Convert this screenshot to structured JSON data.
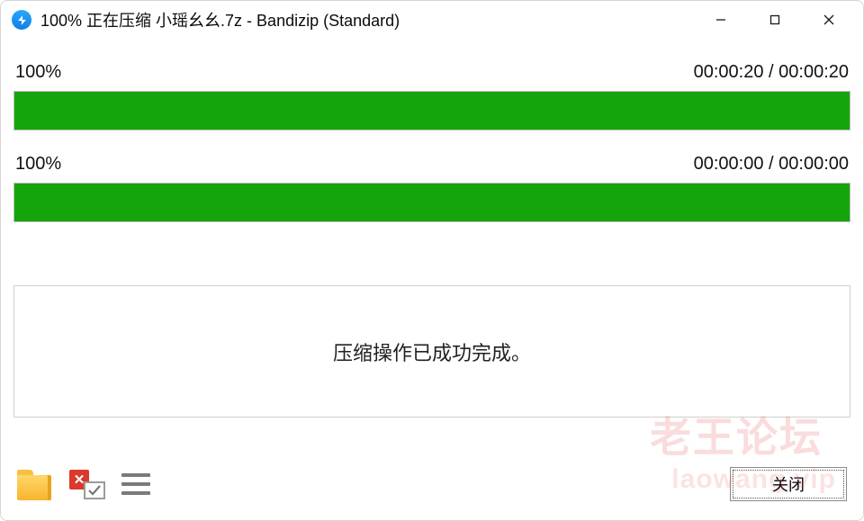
{
  "window": {
    "title": "100% 正在压缩 小瑶幺幺.7z - Bandizip (Standard)"
  },
  "progress1": {
    "percent_label": "100%",
    "percent_value": 100,
    "time_label": "00:00:20 / 00:00:20"
  },
  "progress2": {
    "percent_label": "100%",
    "percent_value": 100,
    "time_label": "00:00:00 / 00:00:00"
  },
  "message": {
    "text": "压缩操作已成功完成。"
  },
  "footer": {
    "close_label": "关闭"
  },
  "watermark": {
    "line1": "老王论坛",
    "line2": "laowang.vip"
  }
}
